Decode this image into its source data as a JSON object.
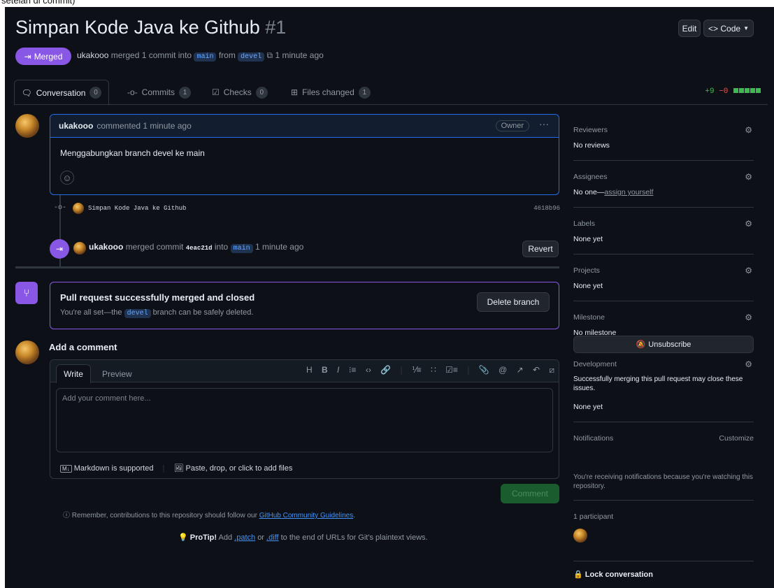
{
  "top_caption": "setelah di commit)",
  "header": {
    "title": "Simpan Kode Java ke Github",
    "number": "#1",
    "edit_label": "Edit",
    "code_label": "<> Code",
    "status_label": "Merged",
    "author": "ukakooo",
    "merged_text": "merged 1 commit into",
    "base_branch": "main",
    "from_text": "from",
    "head_branch": "devel",
    "time": "1 minute ago"
  },
  "tabs": [
    {
      "label": "Conversation",
      "count": "0",
      "icon": "conversation-icon"
    },
    {
      "label": "Commits",
      "count": "1",
      "icon": "commit-icon"
    },
    {
      "label": "Checks",
      "count": "0",
      "icon": "checks-icon"
    },
    {
      "label": "Files changed",
      "count": "1",
      "icon": "file-diff-icon"
    }
  ],
  "diffstat": {
    "additions": "+9",
    "deletions": "−0"
  },
  "comment": {
    "author": "ukakooo",
    "meta": "commented 1 minute ago",
    "role": "Owner",
    "body": "Menggabungkan branch devel ke main"
  },
  "commit": {
    "message": "Simpan Kode Java ke Github",
    "sha": "4618b96"
  },
  "merge_event": {
    "author": "ukakooo",
    "text": "merged commit",
    "sha": "4eac21d",
    "into": "into",
    "branch": "main",
    "time": "1 minute ago",
    "revert_label": "Revert"
  },
  "merge_status": {
    "title": "Pull request successfully merged and closed",
    "desc_pre": "You're all set—the",
    "branch": "devel",
    "desc_post": "branch can be safely deleted.",
    "delete_label": "Delete branch"
  },
  "add_comment": {
    "heading": "Add a comment",
    "write_tab": "Write",
    "preview_tab": "Preview",
    "placeholder": "Add your comment here...",
    "markdown_note": "Markdown is supported",
    "attach_note": "Paste, drop, or click to add files",
    "submit_label": "Comment"
  },
  "footer": {
    "remember_pre": "Remember, contributions to this repository should follow our",
    "remember_link": "GitHub Community Guidelines",
    "remember_post": ".",
    "protip_label": "ProTip!",
    "protip_pre": "Add",
    "patch": ".patch",
    "or": "or",
    "diff": ".diff",
    "protip_post": "to the end of URLs for Git's plaintext views."
  },
  "sidebar": {
    "reviewers": {
      "label": "Reviewers",
      "value": "No reviews"
    },
    "assignees": {
      "label": "Assignees",
      "value_pre": "No one—",
      "value_link": "assign yourself"
    },
    "labels": {
      "label": "Labels",
      "value": "None yet"
    },
    "projects": {
      "label": "Projects",
      "value": "None yet"
    },
    "milestone": {
      "label": "Milestone",
      "value": "No milestone"
    },
    "development": {
      "label": "Development",
      "note": "Successfully merging this pull request may close these issues.",
      "value": "None yet"
    },
    "notifications": {
      "label": "Notifications",
      "customize": "Customize",
      "button": "Unsubscribe",
      "note": "You're receiving notifications because you're watching this repository."
    },
    "participants": {
      "label": "1 participant"
    },
    "lock": "Lock conversation"
  }
}
